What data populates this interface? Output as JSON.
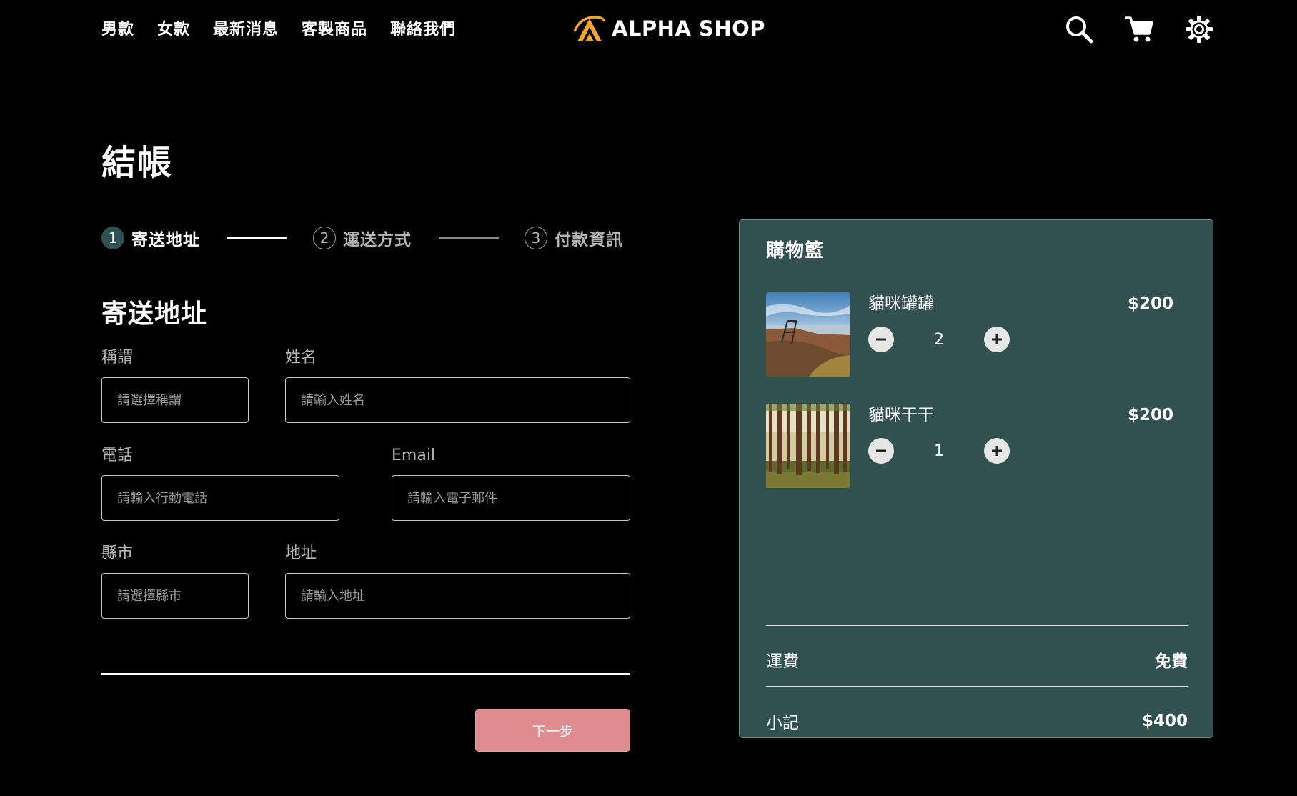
{
  "header": {
    "nav": [
      "男款",
      "女款",
      "最新消息",
      "客製商品",
      "聯絡我們"
    ],
    "logo_text": "ALPHA SHOP",
    "logo_color": "#f5a623",
    "icons": [
      "search-icon",
      "cart-icon",
      "gear-icon"
    ]
  },
  "page_title": "結帳",
  "stepper": {
    "steps": [
      {
        "num": "1",
        "label": "寄送地址",
        "active": true
      },
      {
        "num": "2",
        "label": "運送方式",
        "active": false
      },
      {
        "num": "3",
        "label": "付款資訊",
        "active": false
      }
    ]
  },
  "form": {
    "section_title": "寄送地址",
    "salutation": {
      "label": "稱謂",
      "placeholder": "請選擇稱謂"
    },
    "name": {
      "label": "姓名",
      "placeholder": "請輸入姓名"
    },
    "phone": {
      "label": "電話",
      "placeholder": "請輸入行動電話"
    },
    "email": {
      "label": "Email",
      "placeholder": "請輸入電子郵件"
    },
    "city": {
      "label": "縣市",
      "placeholder": "請選擇縣市"
    },
    "address": {
      "label": "地址",
      "placeholder": "請輸入地址"
    },
    "next_label": "下一步"
  },
  "cart": {
    "title": "購物籃",
    "items": [
      {
        "name": "貓咪罐罐",
        "price": "$200",
        "qty": "2"
      },
      {
        "name": "貓咪干干",
        "price": "$200",
        "qty": "1"
      }
    ],
    "shipping_label": "運費",
    "shipping_value": "免費",
    "subtotal_label": "小記",
    "subtotal_value": "$400"
  },
  "colors": {
    "accent": "#2f5151",
    "next_button": "#e08b90",
    "background": "#000000"
  }
}
